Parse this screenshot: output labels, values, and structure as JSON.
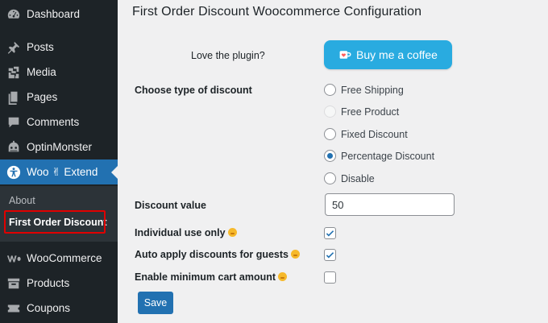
{
  "sidebar": {
    "items": [
      {
        "label": "Dashboard",
        "icon": "dashboard-icon"
      },
      {
        "label": "Posts",
        "icon": "pin-icon"
      },
      {
        "label": "Media",
        "icon": "media-icon"
      },
      {
        "label": "Pages",
        "icon": "pages-icon"
      },
      {
        "label": "Comments",
        "icon": "comment-icon"
      },
      {
        "label": "OptinMonster",
        "icon": "optinmonster-icon"
      },
      {
        "label": "Woo ✌ Extend",
        "icon": "accessibility-icon"
      },
      {
        "label": "WooCommerce",
        "icon": "woo-icon"
      },
      {
        "label": "Products",
        "icon": "archive-icon"
      },
      {
        "label": "Coupons",
        "icon": "ticket-icon"
      }
    ],
    "submenu": {
      "about": "About",
      "current": "First Order Discount"
    },
    "accent_color": "#2271b1",
    "highlight_color": "#e00000"
  },
  "main": {
    "title": "First Order Discount Woocommerce Configuration",
    "love_label": "Love the plugin?",
    "coffee_button": "Buy me a coffee",
    "discount_type_label": "Choose type of discount",
    "discount_options": [
      {
        "label": "Free Shipping",
        "state": "unchecked"
      },
      {
        "label": "Free Product",
        "state": "disabled"
      },
      {
        "label": "Fixed Discount",
        "state": "unchecked"
      },
      {
        "label": "Percentage Discount",
        "state": "checked"
      },
      {
        "label": "Disable",
        "state": "unchecked"
      }
    ],
    "discount_value_label": "Discount value",
    "discount_value": "50",
    "individual_use_label": "Individual use only",
    "individual_use_checked": true,
    "auto_apply_label": "Auto apply discounts for guests",
    "auto_apply_checked": true,
    "min_cart_label": "Enable minimum cart amount",
    "min_cart_checked": false,
    "save_label": "Save"
  }
}
